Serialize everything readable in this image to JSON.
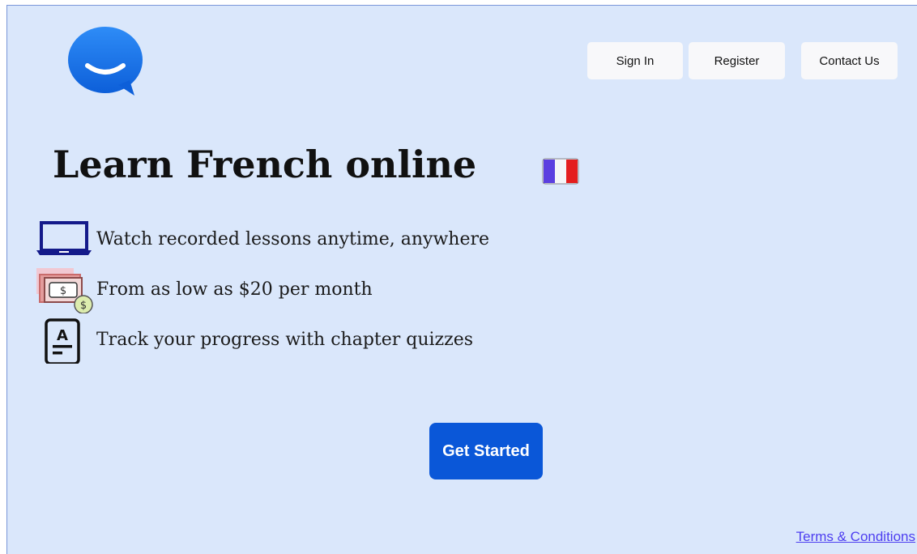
{
  "header": {
    "logo_icon": "chat-bubble-smile-icon",
    "nav": [
      {
        "label": "Sign In"
      },
      {
        "label": "Register"
      },
      {
        "label": "Contact Us"
      }
    ]
  },
  "hero": {
    "title": "Learn French online",
    "flag_icon": "france-flag-icon"
  },
  "features": [
    {
      "icon": "laptop-icon",
      "text": "Watch recorded lessons anytime, anywhere"
    },
    {
      "icon": "money-icon",
      "text": "From as low as $20 per month"
    },
    {
      "icon": "quiz-document-icon",
      "text": "Track your progress with chapter quizzes"
    }
  ],
  "cta": {
    "label": "Get Started"
  },
  "footer": {
    "terms_label": "Terms & Conditions"
  },
  "colors": {
    "background": "#dae7fb",
    "brand_blue": "#0a57d8",
    "nav_button": "#f8f8fa",
    "link": "#4d3ef0"
  }
}
